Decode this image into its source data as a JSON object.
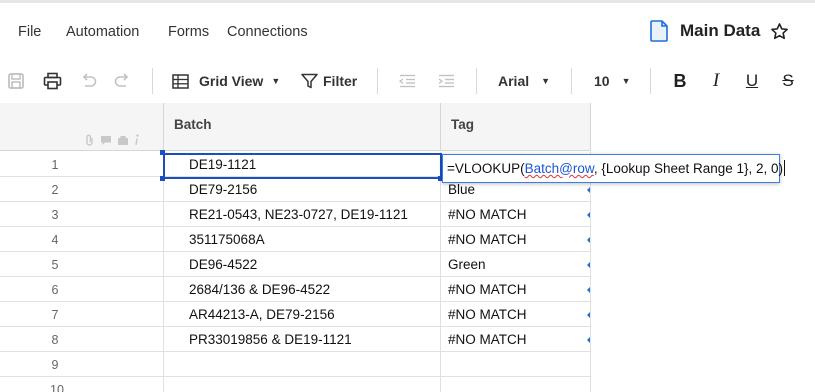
{
  "menu": {
    "file": "File",
    "automation": "Automation",
    "forms": "Forms",
    "connections": "Connections"
  },
  "sheet": {
    "title": "Main Data",
    "icon": "sheet-doc-icon",
    "favorite_icon": "star-icon"
  },
  "toolbar": {
    "view_label": "Grid View",
    "filter_label": "Filter",
    "font_name": "Arial",
    "font_size": "10",
    "icons": [
      "save-icon",
      "print-icon",
      "undo-icon",
      "redo-icon",
      "grid-view-icon",
      "filter-icon",
      "outdent-icon",
      "indent-icon",
      "bold-icon",
      "italic-icon",
      "underline-icon",
      "strikethrough-icon"
    ],
    "bold": "B",
    "italic": "I",
    "underline": "U",
    "strike": "S"
  },
  "columns": [
    {
      "label": "Batch"
    },
    {
      "label": "Tag"
    }
  ],
  "header_icons": [
    "attachment-icon",
    "comment-icon",
    "lock-icon",
    "info-icon"
  ],
  "rows": [
    {
      "num": "1",
      "batch": "DE19-1121",
      "tag": ""
    },
    {
      "num": "2",
      "batch": "DE79-2156",
      "tag": "Blue"
    },
    {
      "num": "3",
      "batch": "RE21-0543, NE23-0727, DE19-1121",
      "tag": "#NO MATCH"
    },
    {
      "num": "4",
      "batch": "351175068A",
      "tag": "#NO MATCH"
    },
    {
      "num": "5",
      "batch": "DE96-4522",
      "tag": "Green"
    },
    {
      "num": "6",
      "batch": "2684/136 & DE96-4522",
      "tag": "#NO MATCH"
    },
    {
      "num": "7",
      "batch": "AR44213-A, DE79-2156",
      "tag": "#NO MATCH"
    },
    {
      "num": "8",
      "batch": "PR33019856 & DE19-1121",
      "tag": "#NO MATCH"
    },
    {
      "num": "9",
      "batch": "",
      "tag": ""
    },
    {
      "num": "10",
      "batch": "",
      "tag": ""
    }
  ],
  "formula": {
    "prefix": "=VLOOKUP(",
    "ref": "Batch@row",
    "suffix": ", {Lookup Sheet Range 1}, 2, 0)"
  },
  "colors": {
    "accent": "#1a4fc4",
    "reference": "#1a56d6",
    "header_bg": "#f5f5f5"
  }
}
